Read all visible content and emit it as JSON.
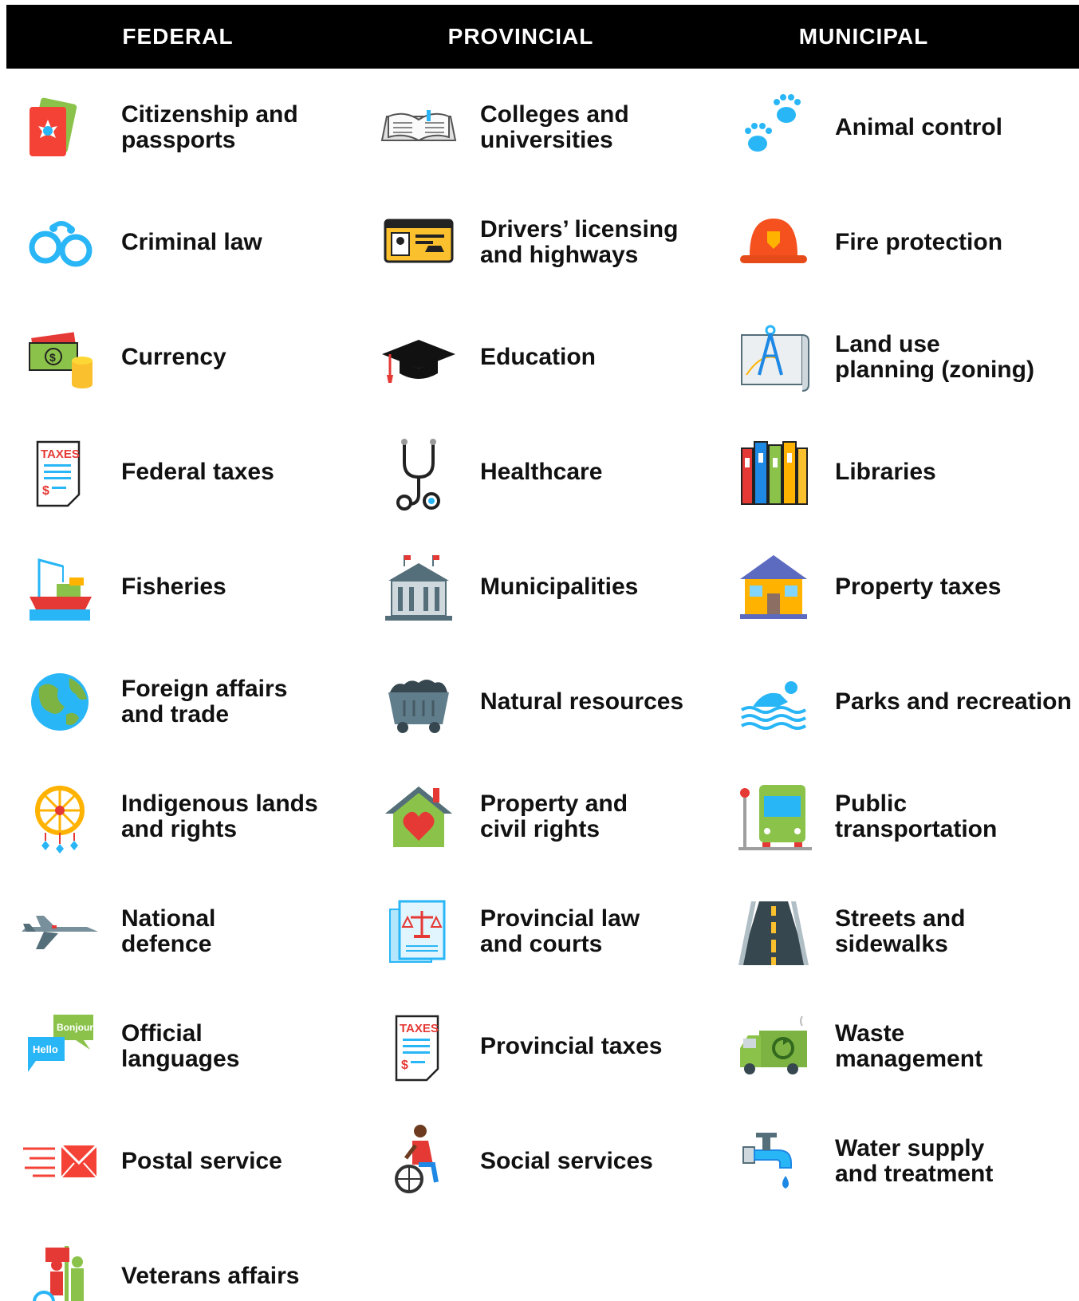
{
  "headers": [
    "FEDERAL",
    "PROVINCIAL",
    "MUNICIPAL"
  ],
  "colors": {
    "header_bg": "#000000",
    "header_text": "#ffffff",
    "text": "#111111"
  },
  "columns": [
    {
      "name": "federal",
      "items": [
        {
          "label": "Citizenship and\npassports",
          "icon": "passport-icon"
        },
        {
          "label": "Criminal law",
          "icon": "handcuffs-icon"
        },
        {
          "label": "Currency",
          "icon": "money-icon"
        },
        {
          "label": "Federal taxes",
          "icon": "tax-document-icon"
        },
        {
          "label": "Fisheries",
          "icon": "fishing-boat-icon"
        },
        {
          "label": "Foreign affairs\nand trade",
          "icon": "globe-icon"
        },
        {
          "label": "Indigenous lands\nand rights",
          "icon": "dreamcatcher-icon"
        },
        {
          "label": "National\ndefence",
          "icon": "fighter-jet-icon"
        },
        {
          "label": "Official\nlanguages",
          "icon": "speech-bubbles-icon"
        },
        {
          "label": "Postal service",
          "icon": "envelope-icon"
        },
        {
          "label": "Veterans affairs",
          "icon": "veterans-icon"
        }
      ]
    },
    {
      "name": "provincial",
      "items": [
        {
          "label": "Colleges and\nuniversities",
          "icon": "open-book-icon"
        },
        {
          "label": "Drivers’ licensing\nand highways",
          "icon": "drivers-license-icon"
        },
        {
          "label": "Education",
          "icon": "graduation-cap-icon"
        },
        {
          "label": "Healthcare",
          "icon": "stethoscope-icon"
        },
        {
          "label": "Municipalities",
          "icon": "town-hall-icon"
        },
        {
          "label": "Natural resources",
          "icon": "mine-cart-icon"
        },
        {
          "label": "Property and\ncivil rights",
          "icon": "house-heart-icon"
        },
        {
          "label": "Provincial law\nand courts",
          "icon": "law-document-icon"
        },
        {
          "label": "Provincial taxes",
          "icon": "tax-document-icon"
        },
        {
          "label": "Social services",
          "icon": "wheelchair-icon"
        }
      ]
    },
    {
      "name": "municipal",
      "items": [
        {
          "label": "Animal control",
          "icon": "paw-prints-icon"
        },
        {
          "label": "Fire protection",
          "icon": "fire-helmet-icon"
        },
        {
          "label": "Land use\nplanning (zoning)",
          "icon": "blueprint-compass-icon"
        },
        {
          "label": "Libraries",
          "icon": "books-icon"
        },
        {
          "label": "Property taxes",
          "icon": "house-icon"
        },
        {
          "label": "Parks and recreation",
          "icon": "swimmer-icon"
        },
        {
          "label": "Public\ntransportation",
          "icon": "bus-icon"
        },
        {
          "label": "Streets and\nsidewalks",
          "icon": "road-icon"
        },
        {
          "label": "Waste\nmanagement",
          "icon": "recycling-truck-icon"
        },
        {
          "label": "Water supply\nand treatment",
          "icon": "water-tap-icon"
        }
      ]
    }
  ]
}
